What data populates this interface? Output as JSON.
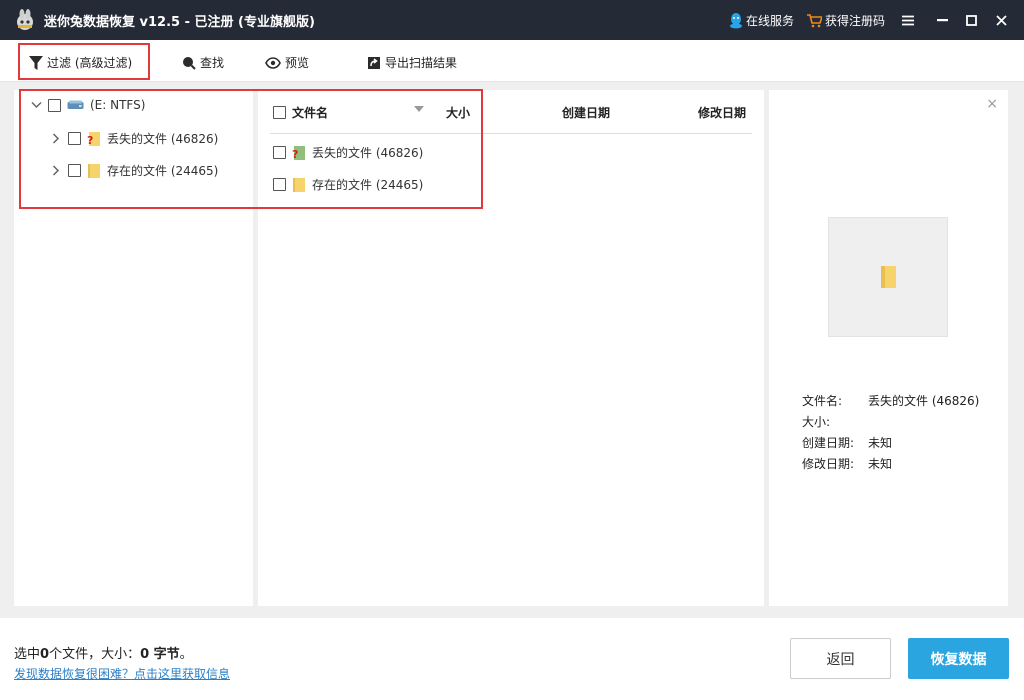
{
  "titlebar": {
    "title": "迷你兔数据恢复 v12.5 - 已注册 (专业旗舰版)",
    "online_service": "在线服务",
    "get_code": "获得注册码"
  },
  "toolbar": {
    "filter": "过滤 (高级过滤)",
    "find": "查找",
    "preview": "预览",
    "export": "导出扫描结果"
  },
  "tree": {
    "root": "(E: NTFS)",
    "items": [
      {
        "label": "丢失的文件 (46826)"
      },
      {
        "label": "存在的文件 (24465)"
      }
    ]
  },
  "list": {
    "columns": {
      "name": "文件名",
      "size": "大小",
      "created": "创建日期",
      "modified": "修改日期"
    },
    "rows": [
      {
        "name": "丢失的文件 (46826)"
      },
      {
        "name": "存在的文件 (24465)"
      }
    ]
  },
  "preview": {
    "close": "×",
    "labels": {
      "name": "文件名:",
      "size": "大小:",
      "created": "创建日期:",
      "modified": "修改日期:"
    },
    "values": {
      "name": "丢失的文件 (46826)",
      "size": "",
      "created": "未知",
      "modified": "未知"
    }
  },
  "footer": {
    "status_prefix": "选中",
    "file_count": "0",
    "status_mid": "个文件，大小：",
    "size_value": "0 字节",
    "status_suffix": "。",
    "help_link": "发现数据恢复很困难？点击这里获取信息",
    "back": "返回",
    "recover": "恢复数据"
  },
  "colors": {
    "titlebar": "#252a37",
    "accent": "#2aa5e0",
    "highlight": "#e0393e",
    "link": "#2a7fc8"
  }
}
